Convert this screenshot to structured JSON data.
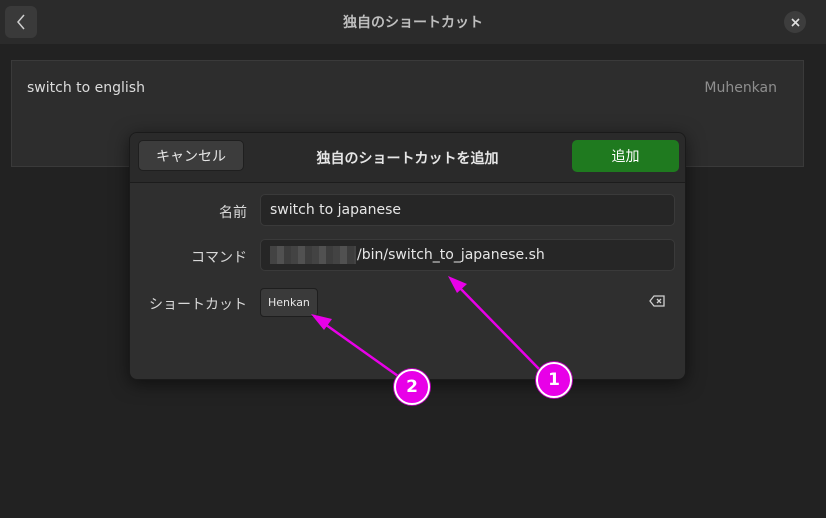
{
  "window": {
    "title": "独自のショートカット",
    "back_icon": "chevron-left-icon",
    "close_icon": "close-icon"
  },
  "background_list": {
    "rows": [
      {
        "name": "switch to english",
        "shortcut": "Muhenkan"
      }
    ]
  },
  "dialog": {
    "title": "独自のショートカットを追加",
    "cancel_label": "キャンセル",
    "add_label": "追加",
    "name_label": "名前",
    "name_value": "switch to japanese",
    "command_label": "コマンド",
    "command_value": "/bin/switch_to_japanese.sh",
    "shortcut_label": "ショートカット",
    "shortcut_value": "Henkan",
    "clear_icon": "backspace-clear-icon"
  },
  "annotations": [
    {
      "label": "1",
      "color": "#e800e8"
    },
    {
      "label": "2",
      "color": "#e800e8"
    }
  ],
  "colors": {
    "accent_green": "#1f7a1f",
    "annotation_magenta": "#e800e8"
  }
}
